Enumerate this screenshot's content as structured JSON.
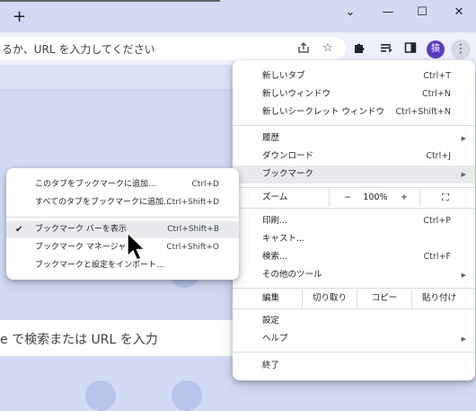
{
  "tabstrip": {
    "new_tab": "+",
    "tab_list": "⌄",
    "minimize": "—",
    "maximize": "☐",
    "close": "✕"
  },
  "toolbar": {
    "omnibox_text": "るか、URL を入力してください",
    "profile_initial": "猿"
  },
  "page": {
    "search_text": "e で検索または URL を入力"
  },
  "main_menu": {
    "new_tab": {
      "label": "新しいタブ",
      "shortcut": "Ctrl+T"
    },
    "new_window": {
      "label": "新しいウィンドウ",
      "shortcut": "Ctrl+N"
    },
    "new_incognito": {
      "label": "新しいシークレット ウィンドウ",
      "shortcut": "Ctrl+Shift+N"
    },
    "history": {
      "label": "履歴"
    },
    "downloads": {
      "label": "ダウンロード",
      "shortcut": "Ctrl+J"
    },
    "bookmarks": {
      "label": "ブックマーク"
    },
    "zoom": {
      "label": "ズーム",
      "minus": "−",
      "value": "100%",
      "plus": "+"
    },
    "print": {
      "label": "印刷...",
      "shortcut": "Ctrl+P"
    },
    "cast": {
      "label": "キャスト..."
    },
    "find": {
      "label": "検索...",
      "shortcut": "Ctrl+F"
    },
    "more_tools": {
      "label": "その他のツール"
    },
    "edit": {
      "label": "編集",
      "cut": "切り取り",
      "copy": "コピー",
      "paste": "貼り付け"
    },
    "settings": {
      "label": "設定"
    },
    "help": {
      "label": "ヘルプ"
    },
    "exit": {
      "label": "終了"
    }
  },
  "bookmark_menu": {
    "bookmark_tab": {
      "label": "このタブをブックマークに追加...",
      "shortcut": "Ctrl+D"
    },
    "bookmark_all_tabs": {
      "label": "すべてのタブをブックマークに追加...",
      "shortcut": "Ctrl+Shift+D"
    },
    "show_bookmark_bar": {
      "label": "ブックマーク バーを表示",
      "shortcut": "Ctrl+Shift+B",
      "checked": true
    },
    "bookmark_manager": {
      "label": "ブックマーク マネージャ",
      "shortcut": "Ctrl+Shift+O"
    },
    "import": {
      "label": "ブックマークと設定をインポート..."
    }
  },
  "colors": {
    "background": "#d3dbf4",
    "menu_highlight": "#e8eaed",
    "profile": "#5b3cc4"
  }
}
